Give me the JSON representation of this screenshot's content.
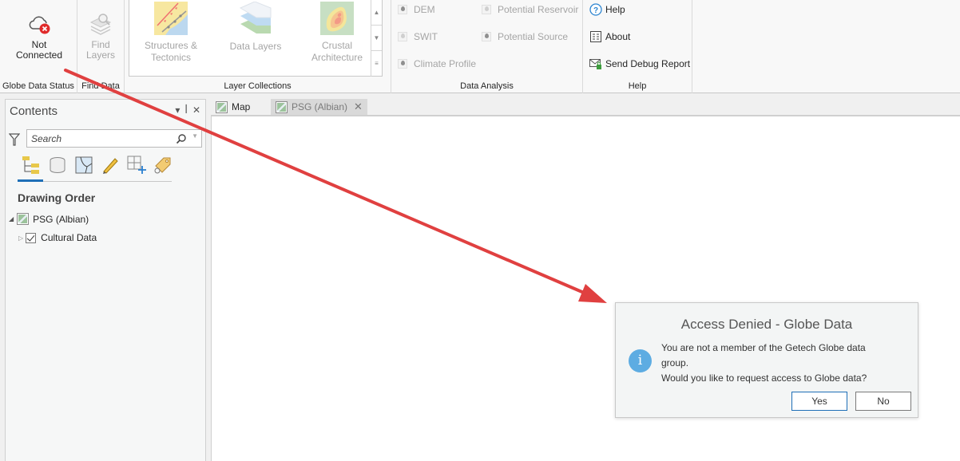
{
  "ribbon": {
    "globe_status": {
      "button_label_1": "Not",
      "button_label_2": "Connected",
      "group_label": "Globe Data Status"
    },
    "find_data": {
      "button_label_1": "Find",
      "button_label_2": "Layers",
      "group_label": "Find Data"
    },
    "layer_collections": {
      "group_label": "Layer Collections",
      "items": [
        {
          "label_1": "Structures &",
          "label_2": "Tectonics"
        },
        {
          "label_1": "Data Layers",
          "label_2": ""
        },
        {
          "label_1": "Crustal",
          "label_2": "Architecture"
        }
      ]
    },
    "data_analysis": {
      "group_label": "Data Analysis",
      "items": [
        "DEM",
        "Potential Reservoir",
        "SWIT",
        "Potential Source",
        "Climate Profile"
      ]
    },
    "help": {
      "group_label": "Help",
      "items": [
        "Help",
        "About",
        "Send Debug Report"
      ]
    }
  },
  "contents": {
    "title": "Contents",
    "search_placeholder": "Search",
    "section_title": "Drawing Order",
    "tree": [
      {
        "label": "PSG (Albian)",
        "expanded": true
      },
      {
        "label": "Cultural Data",
        "checked": true,
        "expanded": false
      }
    ]
  },
  "tabs": [
    {
      "label": "Map",
      "active": true
    },
    {
      "label": "PSG (Albian)",
      "active": false
    }
  ],
  "dialog": {
    "title": "Access Denied - Globe Data",
    "message_line_1": "You are not a member of the Getech Globe data",
    "message_line_2": "group.",
    "message_line_3": "Would you like to request access to Globe data?",
    "yes_label": "Yes",
    "no_label": "No",
    "icon": "info-icon"
  },
  "colors": {
    "accent": "#1f6fb7",
    "annotation_arrow": "#e04040",
    "info_icon": "#5dace2"
  }
}
